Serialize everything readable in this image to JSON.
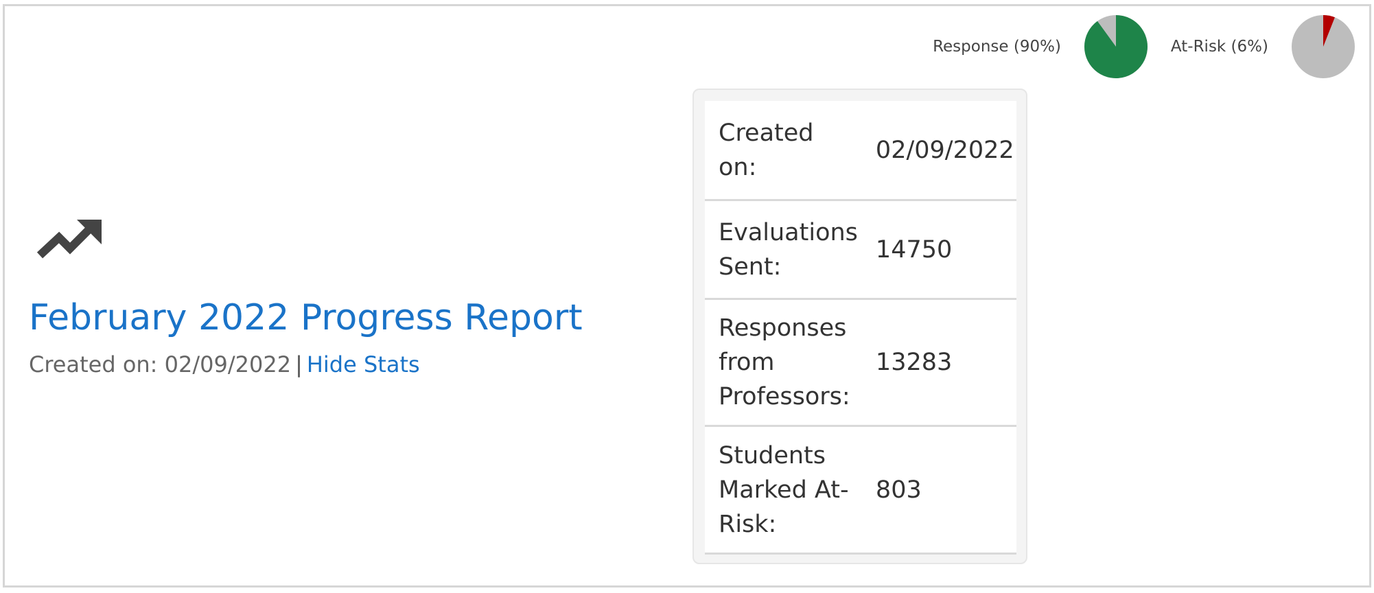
{
  "header": {
    "pies": [
      {
        "label": "Response (90%)",
        "value": 90,
        "color": "#1e8449",
        "rest_color": "#bdbdbd"
      },
      {
        "label": "At-Risk (6%)",
        "value": 6,
        "color": "#b30000",
        "rest_color": "#bdbdbd"
      }
    ]
  },
  "report": {
    "icon": "trending-up-icon",
    "title": "February 2022 Progress Report",
    "created_prefix": "Created on: 02/09/2022",
    "separator": "|",
    "toggle_label": "Hide Stats"
  },
  "stats": {
    "rows": [
      {
        "label": "Created on:",
        "value": "02/09/2022"
      },
      {
        "label": "Evaluations Sent:",
        "value": "14750"
      },
      {
        "label": "Responses from Professors:",
        "value": "13283"
      },
      {
        "label": "Students Marked At-Risk:",
        "value": "803"
      }
    ]
  }
}
